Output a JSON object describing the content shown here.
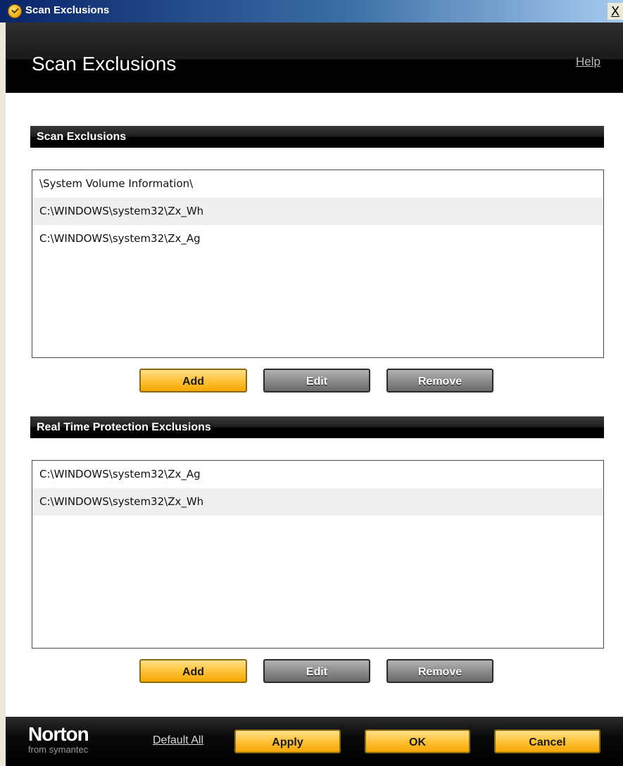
{
  "window": {
    "title": "Scan Exclusions",
    "close_glyph": "X"
  },
  "header": {
    "title": "Scan Exclusions",
    "help_link": "Help"
  },
  "scan_section": {
    "title": "Scan Exclusions",
    "items": [
      "\\System Volume Information\\",
      "C:\\WINDOWS\\system32\\Zx_Wh",
      "C:\\WINDOWS\\system32\\Zx_Ag"
    ],
    "buttons": {
      "add": "Add",
      "edit": "Edit",
      "remove": "Remove"
    }
  },
  "rtp_section": {
    "title": "Real Time Protection Exclusions",
    "items": [
      "C:\\WINDOWS\\system32\\Zx_Ag",
      "C:\\WINDOWS\\system32\\Zx_Wh"
    ],
    "buttons": {
      "add": "Add",
      "edit": "Edit",
      "remove": "Remove"
    }
  },
  "footer": {
    "logo_brand": "Norton",
    "logo_tagline": "from symantec",
    "default_all": "Default All",
    "apply": "Apply",
    "ok": "OK",
    "cancel": "Cancel"
  },
  "colors": {
    "accent_gold": "#ffc640",
    "header_black": "#000000",
    "button_gray": "#8c8c8c"
  },
  "icons": {
    "app": "norton-shield-icon",
    "close": "close-icon"
  }
}
